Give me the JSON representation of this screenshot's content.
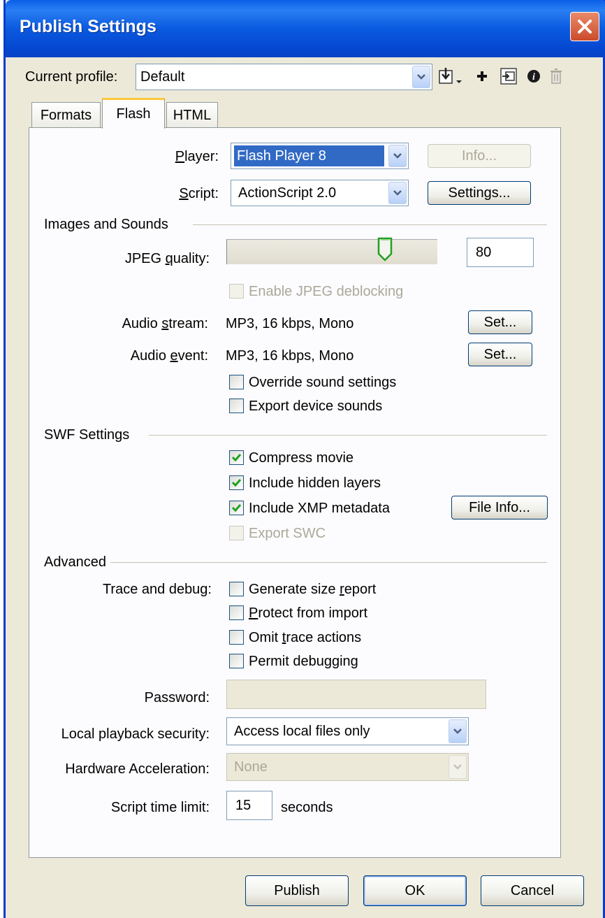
{
  "window": {
    "title": "Publish Settings"
  },
  "profile": {
    "label_prefix": "Current profile:",
    "value": "Default",
    "toolbar": [
      "import-export-icon",
      "add-profile-icon",
      "duplicate-profile-icon",
      "profile-info-icon",
      "delete-profile-icon"
    ]
  },
  "tabs": [
    {
      "label": "Formats"
    },
    {
      "label": "Flash"
    },
    {
      "label": "HTML"
    }
  ],
  "flash": {
    "player": {
      "label_pre": "",
      "label_mn": "P",
      "label_post": "layer:",
      "value": "Flash Player 8",
      "info_button": "Info..."
    },
    "script": {
      "label_mn": "S",
      "label_post": "cript:",
      "value": "ActionScript 2.0",
      "settings_button": "Settings..."
    },
    "images_sounds": {
      "heading": "Images and Sounds",
      "jpeg_label_pre": "JPEG ",
      "jpeg_label_mn": "q",
      "jpeg_label_post": "uality:",
      "jpeg_value": "80",
      "jpeg_fraction": 0.8,
      "deblocking": "Enable JPEG deblocking",
      "audio_stream_pre": "Audio ",
      "audio_stream_mn": "s",
      "audio_stream_post": "tream:",
      "audio_stream_value": "MP3, 16 kbps, Mono",
      "audio_event_pre": "Audio ",
      "audio_event_mn": "e",
      "audio_event_post": "vent:",
      "audio_event_value": "MP3, 16 kbps, Mono",
      "set_button": "Set...",
      "override": "Override sound settings",
      "export_device": "Export device sounds"
    },
    "swf": {
      "heading": "SWF Settings",
      "compress": "Compress movie",
      "hidden_layers": "Include hidden layers",
      "xmp": "Include XMP metadata",
      "file_info_button": "File Info...",
      "export_swc": "Export SWC"
    },
    "advanced": {
      "heading": "Advanced",
      "trace_label": "Trace and debug:",
      "size_report_pre": "Generate size ",
      "size_report_mn": "r",
      "size_report_post": "eport",
      "protect_mn": "P",
      "protect_post": "rotect from import",
      "omit_pre": "Omit ",
      "omit_mn": "t",
      "omit_post": "race actions",
      "permit_pre": "Permit debu",
      "permit_mn": "g",
      "permit_post": "ging",
      "password_label": "Password:",
      "password_value": "",
      "local_security_label": "Local playback security:",
      "local_security_value": "Access local files only",
      "hw_label": "Hardware Acceleration:",
      "hw_value": "None",
      "time_limit_label": "Script time limit:",
      "time_limit_value": "15",
      "seconds": "seconds"
    }
  },
  "buttons": {
    "publish": "Publish",
    "ok": "OK",
    "cancel": "Cancel"
  },
  "colors": {
    "titlebar": "#0a5ae0",
    "face": "#ece9d8",
    "selection": "#316ac5",
    "check": "#21a121",
    "close": "#d2573a"
  }
}
